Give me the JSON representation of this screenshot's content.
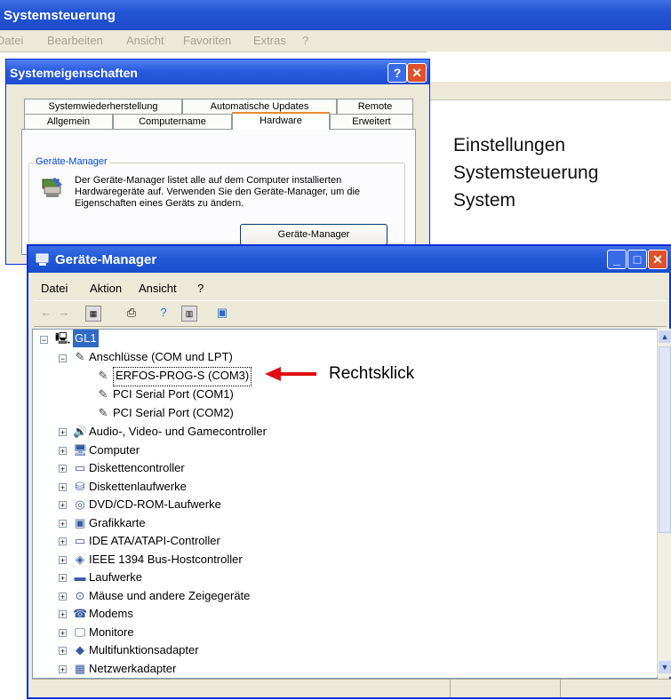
{
  "bg_window": {
    "title": "Systemsteuerung",
    "menu": [
      "Datei",
      "Bearbeiten",
      "Ansicht",
      "Favoriten",
      "Extras",
      "?"
    ]
  },
  "caption": {
    "lines": [
      "Einstellungen",
      "Systemsteuerung",
      "System"
    ]
  },
  "dialog": {
    "title": "Systemeigenschaften",
    "help_glyph": "?",
    "close_glyph": "✕",
    "tabs_back": [
      "Systemwiederherstellung",
      "Automatische Updates",
      "Remote"
    ],
    "tabs_front": [
      "Allgemein",
      "Computername",
      "Hardware",
      "Erweitert"
    ],
    "group_label": "Geräte-Manager",
    "group_text": "Der Geräte-Manager listet alle auf dem Computer installierten Hardwaregeräte auf. Verwenden Sie den Geräte-Manager, um die Eigenschaften eines Geräts zu ändern.",
    "button": "Geräte-Manager"
  },
  "device_manager": {
    "title": "Geräte-Manager",
    "menu": [
      "Datei",
      "Aktion",
      "Ansicht",
      "?"
    ],
    "toolbar_icons": [
      "back-icon",
      "forward-icon",
      "properties-icon",
      "print-icon",
      "help-icon",
      "view-icon",
      "scan-icon"
    ],
    "tree": {
      "root": "GL1",
      "expanded_category": "Anschlüsse (COM und LPT)",
      "ports": [
        "ERFOS-PROG-S (COM3)",
        "PCI Serial Port (COM1)",
        "PCI Serial Port (COM2)"
      ],
      "categories": [
        "Audio-, Video- und Gamecontroller",
        "Computer",
        "Diskettencontroller",
        "Diskettenlaufwerke",
        "DVD/CD-ROM-Laufwerke",
        "Grafikkarte",
        "IDE ATA/ATAPI-Controller",
        "IEEE 1394 Bus-Hostcontroller",
        "Laufwerke",
        "Mäuse und andere Zeigegeräte",
        "Modems",
        "Monitore",
        "Multifunktionsadapter",
        "Netzwerkadapter"
      ]
    }
  },
  "annotation": {
    "label": "Rechtsklick",
    "color": "#e01010"
  }
}
